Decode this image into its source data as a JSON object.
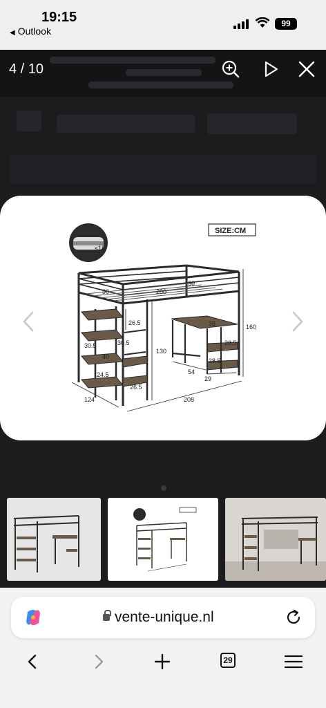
{
  "status_bar": {
    "time": "19:15",
    "back_app": "Outlook",
    "battery": "99"
  },
  "viewer": {
    "counter": "4 / 10"
  },
  "image": {
    "size_label": "SIZE:CM",
    "dims": {
      "mattress": "≤18",
      "rail": "30",
      "bed_length": "200",
      "bed_width": "90",
      "desk_width": "38",
      "height": "160",
      "step1": "26.5",
      "step2": "30.5",
      "step3": "30.5",
      "shelf_w": "40",
      "shelf_d": "24.5",
      "shelf_h": "26.5",
      "under_h": "130",
      "desk_h1": "28.5",
      "desk_h2": "28.5",
      "desk_w": "54",
      "desk_d": "29",
      "depth": "124",
      "length": "208"
    }
  },
  "browser": {
    "url": "vente-unique.nl",
    "tabs": "29"
  },
  "colors": {
    "frame": "#2b2b2b",
    "wood": "#6b5a48",
    "card_bg": "#ffffff",
    "backdrop": "#1c1c1f"
  }
}
